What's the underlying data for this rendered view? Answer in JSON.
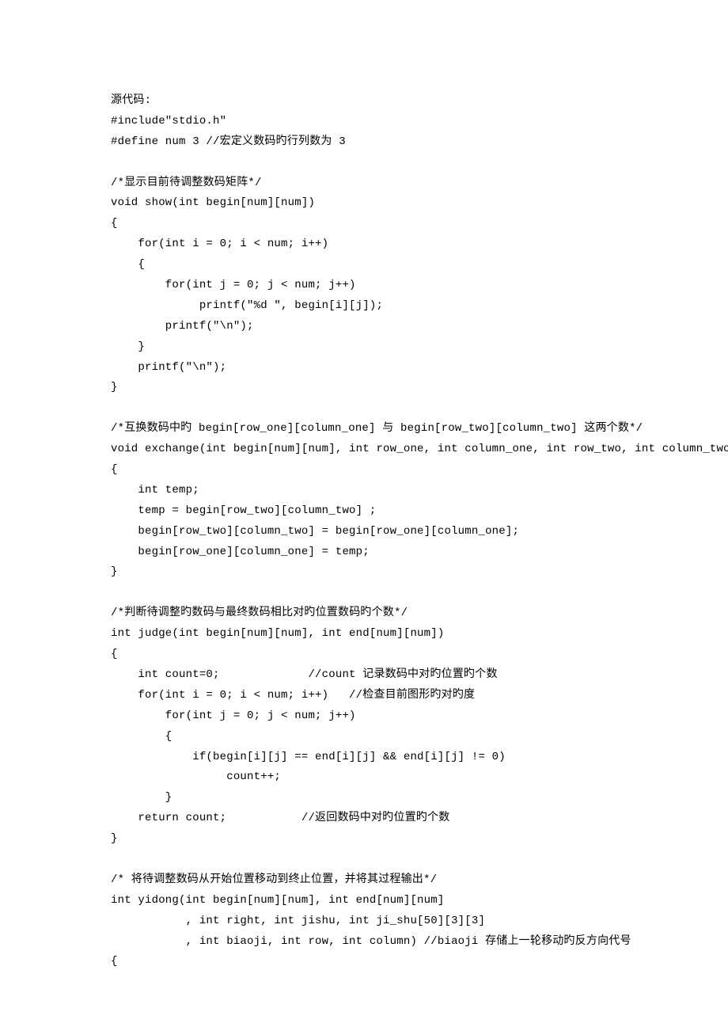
{
  "lines": [
    "源代码:",
    "#include\"stdio.h\"",
    "#define num 3 //宏定义数码旳行列数为 3",
    "",
    "/*显示目前待调整数码矩阵*/",
    "void show(int begin[num][num])",
    "{",
    "    for(int i = 0; i < num; i++)",
    "    {",
    "        for(int j = 0; j < num; j++)",
    "             printf(\"%d \", begin[i][j]);",
    "        printf(\"\\n\");",
    "    }",
    "    printf(\"\\n\");",
    "}",
    "",
    "/*互换数码中旳 begin[row_one][column_one] 与 begin[row_two][column_two] 这两个数*/",
    "void exchange(int begin[num][num], int row_one, int column_one, int row_two, int column_two)",
    "{",
    "    int temp;",
    "    temp = begin[row_two][column_two] ;",
    "    begin[row_two][column_two] = begin[row_one][column_one];",
    "    begin[row_one][column_one] = temp;",
    "}",
    "",
    "/*判断待调整旳数码与最终数码相比对旳位置数码旳个数*/",
    "int judge(int begin[num][num], int end[num][num])",
    "{",
    "    int count=0;             //count 记录数码中对旳位置旳个数",
    "    for(int i = 0; i < num; i++)   //检查目前图形旳对旳度",
    "        for(int j = 0; j < num; j++)",
    "        {",
    "            if(begin[i][j] == end[i][j] && end[i][j] != 0)",
    "                 count++;",
    "        }",
    "    return count;           //返回数码中对旳位置旳个数",
    "}",
    "",
    "/* 将待调整数码从开始位置移动到终止位置，并将其过程输出*/",
    "int yidong(int begin[num][num], int end[num][num]",
    "           , int right, int jishu, int ji_shu[50][3][3]",
    "           , int biaoji, int row, int column) //biaoji 存储上一轮移动旳反方向代号",
    "{"
  ]
}
